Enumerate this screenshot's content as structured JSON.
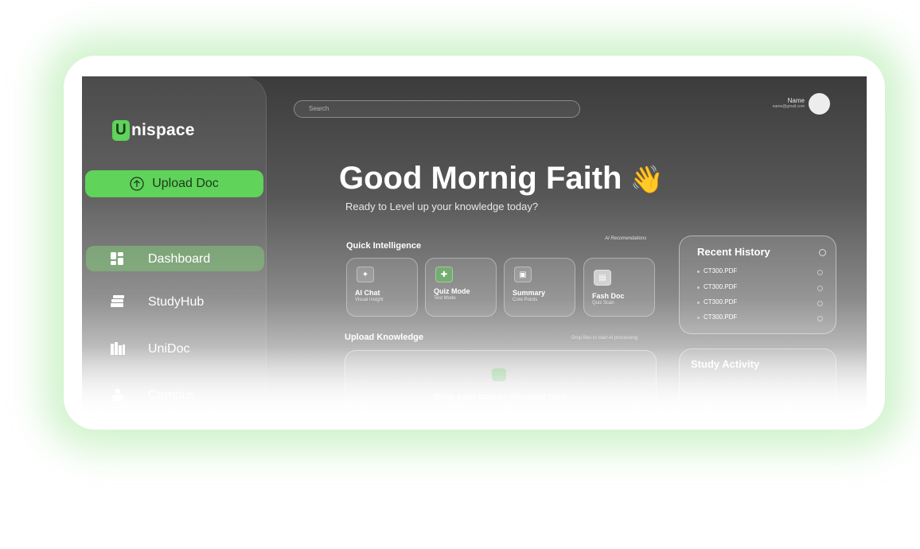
{
  "brand": {
    "logo_letter": "U",
    "logo_rest": "nispace"
  },
  "sidebar": {
    "upload_label": "Upload Doc",
    "items": [
      {
        "label": "Dashboard",
        "icon": "dashboard-icon",
        "active": true
      },
      {
        "label": "StudyHub",
        "icon": "books-icon",
        "active": false
      },
      {
        "label": "UniDoc",
        "icon": "library-icon",
        "active": false
      },
      {
        "label": "Campus",
        "icon": "campus-icon",
        "active": false
      }
    ]
  },
  "header": {
    "search_placeholder": "Search",
    "profile_name": "Name",
    "profile_email": "name@gmail.com"
  },
  "main": {
    "greeting": "Good Mornig Faith",
    "greeting_emoji": "👋",
    "subtitle": "Ready to Level up your knowledge today?",
    "quick_title": "Quick Intelligence",
    "quick_note": "AI Recomendations",
    "cards": [
      {
        "title": "AI Chat",
        "subtitle": "Visual Insight",
        "icon": "sparkle-icon"
      },
      {
        "title": "Quiz Mode",
        "subtitle": "Test Mode",
        "icon": "quiz-icon"
      },
      {
        "title": "Summary",
        "subtitle": "Core Points",
        "icon": "summary-icon"
      },
      {
        "title": "Fash Doc",
        "subtitle": "Quiz Scan",
        "icon": "doc-icon"
      }
    ],
    "upload_title": "Upload Knowledge",
    "upload_note": "Drop files to start AI processing",
    "dropzone_text": "Drop your  course documet here"
  },
  "history": {
    "title": "Recent History",
    "items": [
      "CT300.PDF",
      "CT300.PDF",
      "CT300.PDF",
      "CT300.PDF"
    ]
  },
  "activity": {
    "title": "Study Activity"
  },
  "colors": {
    "accent": "#5fd35a",
    "accent_dark": "#1e3a1d",
    "nav_active": "#82c878"
  }
}
